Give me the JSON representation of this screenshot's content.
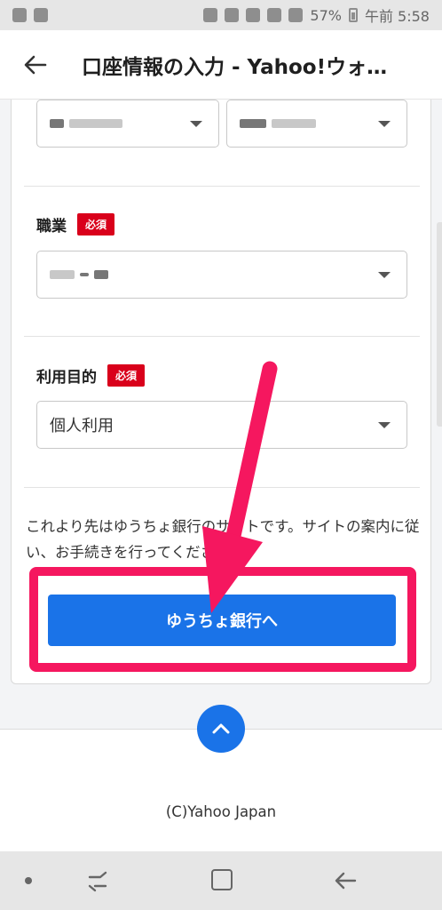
{
  "status_bar": {
    "battery_percent": "57%",
    "time": "午前 5:58"
  },
  "app_bar": {
    "title": "口座情報の入力 - Yahoo!ウォ…"
  },
  "form": {
    "occupation": {
      "label": "職業",
      "required": "必須"
    },
    "purpose": {
      "label": "利用目的",
      "required": "必須",
      "value": "個人利用"
    },
    "notice": "これより先はゆうちょ銀行のサイトです。サイトの案内に従い、お手続きを行ってください。",
    "submit_label": "ゆうちょ銀行へ"
  },
  "footer": {
    "copyright": "(C)Yahoo Japan"
  },
  "colors": {
    "accent": "#1a73e8",
    "required": "#d9001b",
    "highlight": "#f5175f"
  }
}
